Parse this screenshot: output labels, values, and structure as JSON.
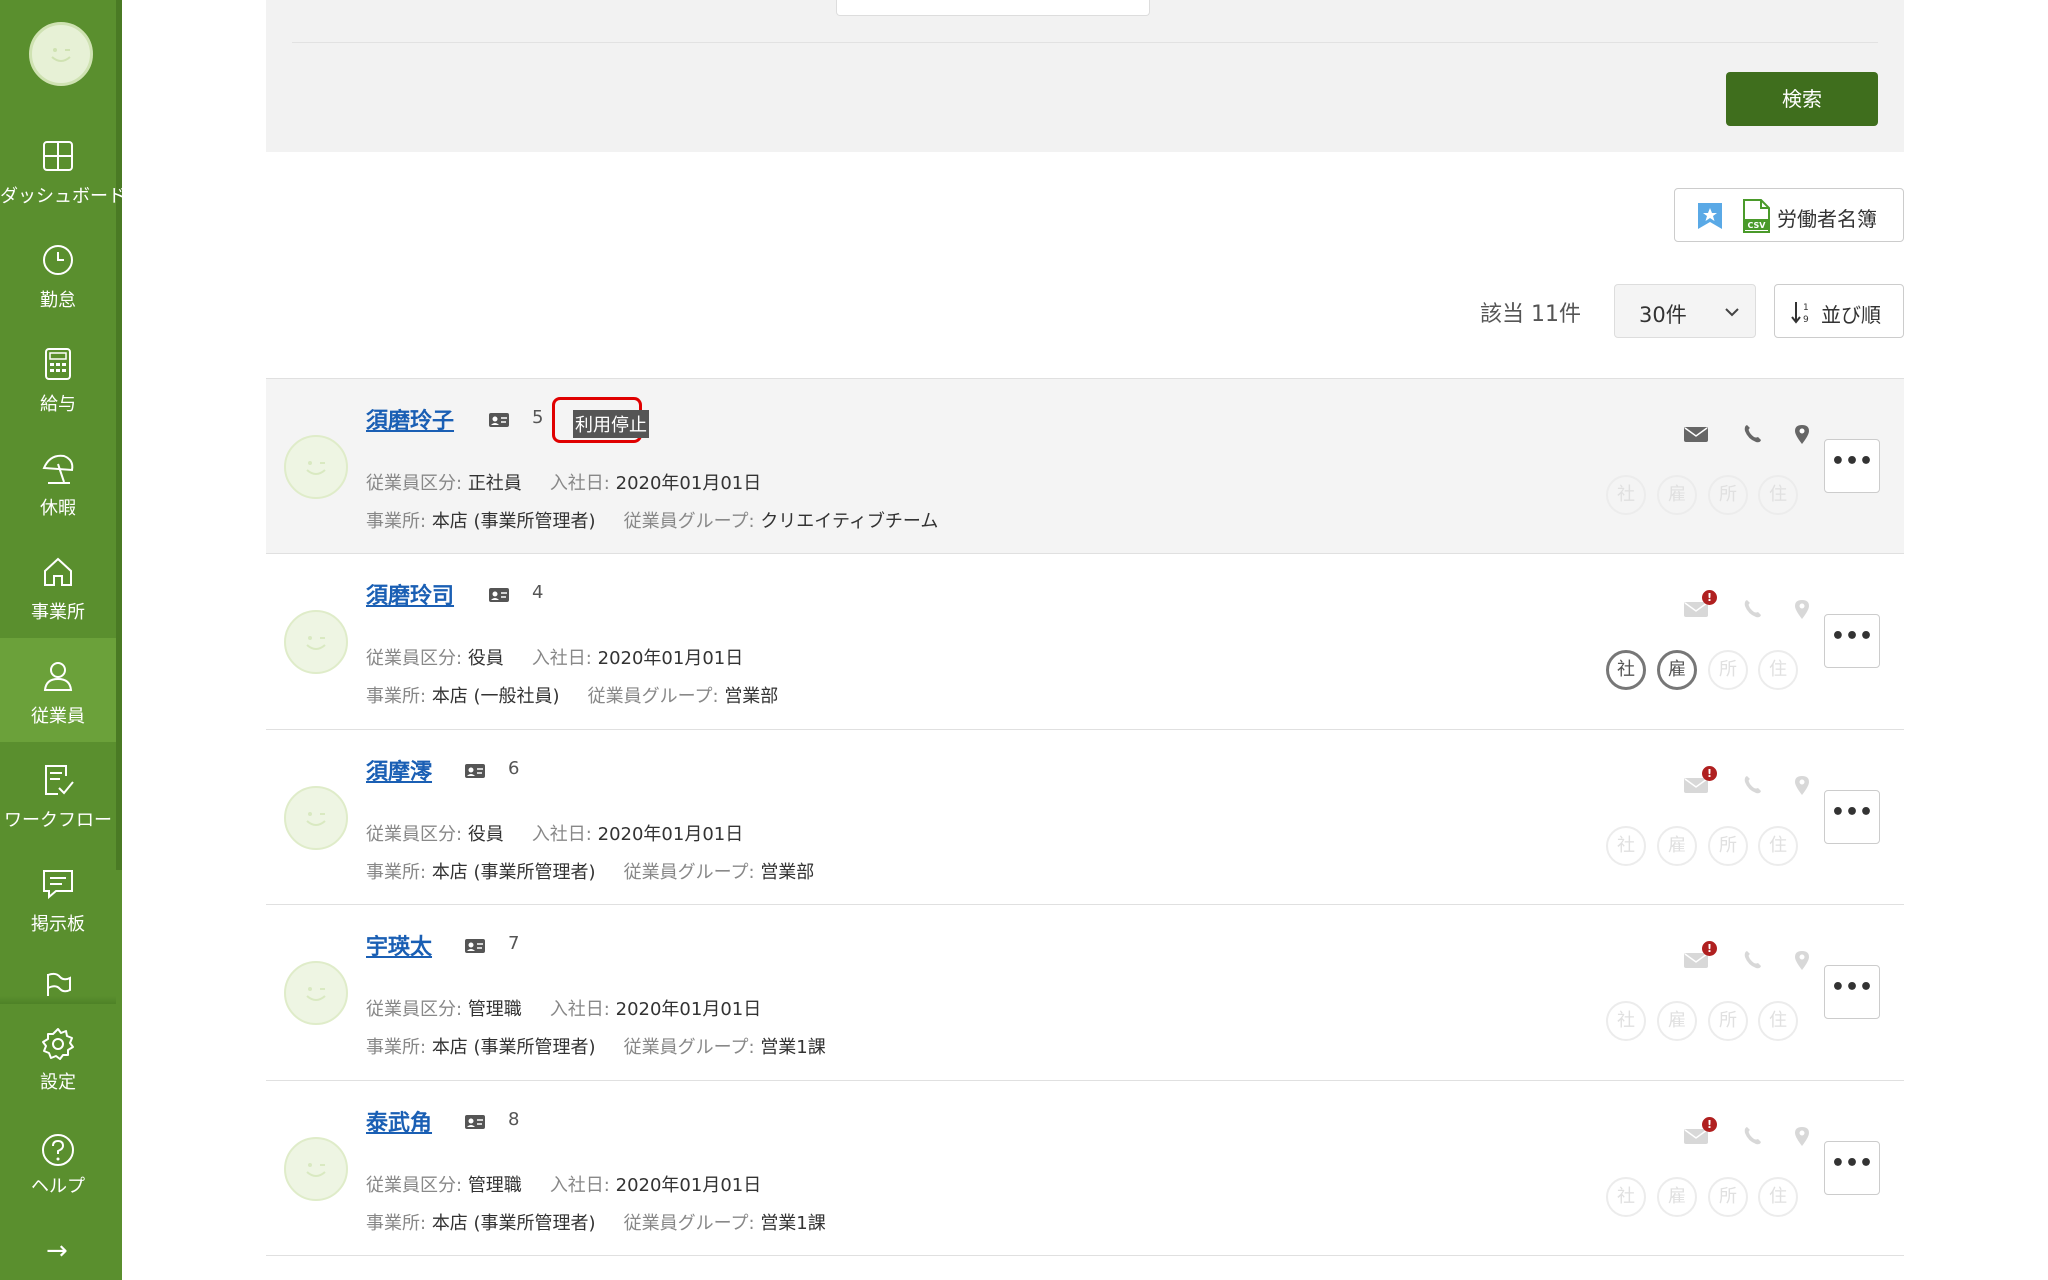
{
  "sidebar": {
    "items": [
      {
        "label": "ダッシュボード",
        "icon": "dashboard-icon"
      },
      {
        "label": "勤怠",
        "icon": "clock-icon"
      },
      {
        "label": "給与",
        "icon": "calculator-icon"
      },
      {
        "label": "休暇",
        "icon": "beach-umbrella-icon"
      },
      {
        "label": "事業所",
        "icon": "home-icon"
      },
      {
        "label": "従業員",
        "icon": "person-icon",
        "active": true
      },
      {
        "label": "ワークフロー",
        "icon": "workflow-icon"
      },
      {
        "label": "掲示板",
        "icon": "message-board-icon"
      },
      {
        "label": "設定",
        "icon": "gear-icon"
      },
      {
        "label": "ヘルプ",
        "icon": "help-icon"
      }
    ],
    "expand_arrow": "→"
  },
  "search": {
    "button_label": "検索"
  },
  "toolbar": {
    "register_label": "労働者名簿"
  },
  "results": {
    "count_label": "該当",
    "count_value": "11件",
    "page_size": "30件",
    "sort_label": "並び順"
  },
  "labels": {
    "employee_type": "従業員区分:",
    "hire_date": "入社日:",
    "office": "事業所:",
    "group": "従業員グループ:"
  },
  "chip_labels": [
    "社",
    "雇",
    "所",
    "住"
  ],
  "more_label": "•••",
  "employees": [
    {
      "name": "須磨玲子",
      "number": "5",
      "status": "利用停止",
      "employee_type": "正社員",
      "hire_date": "2020年01月01日",
      "office": "本店 (事業所管理者)",
      "group": "クリエイティブチーム",
      "alert": false,
      "chips_active": [
        false,
        false,
        false,
        false
      ]
    },
    {
      "name": "須磨玲司",
      "number": "4",
      "status": "",
      "employee_type": "役員",
      "hire_date": "2020年01月01日",
      "office": "本店 (一般社員)",
      "group": "営業部",
      "alert": true,
      "chips_active": [
        true,
        true,
        false,
        false
      ]
    },
    {
      "name": "須摩澪",
      "number": "6",
      "status": "",
      "employee_type": "役員",
      "hire_date": "2020年01月01日",
      "office": "本店 (事業所管理者)",
      "group": "営業部",
      "alert": true,
      "chips_active": [
        false,
        false,
        false,
        false
      ]
    },
    {
      "name": "宇瑛太",
      "number": "7",
      "status": "",
      "employee_type": "管理職",
      "hire_date": "2020年01月01日",
      "office": "本店 (事業所管理者)",
      "group": "営業1課",
      "alert": true,
      "chips_active": [
        false,
        false,
        false,
        false
      ]
    },
    {
      "name": "泰武角",
      "number": "8",
      "status": "",
      "employee_type": "管理職",
      "hire_date": "2020年01月01日",
      "office": "本店 (事業所管理者)",
      "group": "営業1課",
      "alert": true,
      "chips_active": [
        false,
        false,
        false,
        false
      ]
    }
  ],
  "colors": {
    "sidebar": "#5a8f2e",
    "primary_button": "#3f6e1d",
    "link": "#1a5fb4",
    "alert": "#b02020"
  }
}
